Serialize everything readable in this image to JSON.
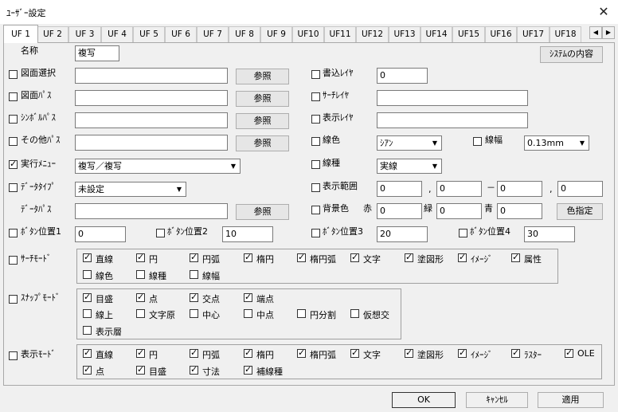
{
  "window": {
    "title": "ﾕｰｻﾞｰ設定",
    "close": "✕"
  },
  "tabs": [
    "UF 1",
    "UF 2",
    "UF 3",
    "UF 4",
    "UF 5",
    "UF 6",
    "UF 7",
    "UF 8",
    "UF 9",
    "UF10",
    "UF11",
    "UF12",
    "UF13",
    "UF14",
    "UF15",
    "UF16",
    "UF17",
    "UF18"
  ],
  "tab_scroll": {
    "left": "◀",
    "right": "▶"
  },
  "name": {
    "label": "名称",
    "value": "複写"
  },
  "system_button": "ｼｽﾃﾑの内容",
  "left_rows": [
    {
      "label": "図面選択",
      "checked": false,
      "value": "",
      "button": "参照"
    },
    {
      "label": "図面ﾊﾟｽ",
      "checked": false,
      "value": "",
      "button": "参照"
    },
    {
      "label": "ｼﾝﾎﾞﾙﾊﾟｽ",
      "checked": false,
      "value": "",
      "button": "参照"
    },
    {
      "label": "その他ﾊﾟｽ",
      "checked": false,
      "value": "",
      "button": "参照"
    }
  ],
  "exec_menu": {
    "label": "実行ﾒﾆｭｰ",
    "checked": true,
    "value": "複写／複写"
  },
  "data_type": {
    "label": "ﾃﾞｰﾀﾀｲﾌﾟ",
    "checked": false,
    "value": "未設定"
  },
  "data_path": {
    "label": "ﾃﾞｰﾀﾊﾟｽ",
    "value": "",
    "button": "参照"
  },
  "right_rows": {
    "write_layer": {
      "label": "書込ﾚｲﾔ",
      "value": "0"
    },
    "search_layer": {
      "label": "ｻｰﾁﾚｲﾔ",
      "value": ""
    },
    "display_layer": {
      "label": "表示ﾚｲﾔ",
      "value": ""
    },
    "line_color": {
      "label": "線色",
      "value": "ｼｱﾝ"
    },
    "line_width": {
      "label": "線幅",
      "value": "0.13mm"
    },
    "line_type": {
      "label": "線種",
      "value": "実線"
    },
    "display_range": {
      "label": "表示範囲",
      "v1": "0",
      "v2": "0",
      "v3": "0",
      "v4": "0",
      "sep1": ",",
      "sep2": "－",
      "sep3": ","
    },
    "background": {
      "label": "背景色",
      "red_label": "赤",
      "red": "0",
      "green_label": "緑",
      "green": "0",
      "blue_label": "青",
      "blue": "0",
      "button": "色指定"
    }
  },
  "button_positions": [
    {
      "label": "ﾎﾞﾀﾝ位置1",
      "value": "0"
    },
    {
      "label": "ﾎﾞﾀﾝ位置2",
      "value": "10"
    },
    {
      "label": "ﾎﾞﾀﾝ位置3",
      "value": "20"
    },
    {
      "label": "ﾎﾞﾀﾝ位置4",
      "value": "30"
    }
  ],
  "search_mode": {
    "label": "ｻｰﾁﾓｰﾄﾞ",
    "options": [
      {
        "label": "直線",
        "checked": true
      },
      {
        "label": "円",
        "checked": true
      },
      {
        "label": "円弧",
        "checked": true
      },
      {
        "label": "楕円",
        "checked": true
      },
      {
        "label": "楕円弧",
        "checked": true
      },
      {
        "label": "文字",
        "checked": true
      },
      {
        "label": "塗図形",
        "checked": true
      },
      {
        "label": "ｲﾒｰｼﾞ",
        "checked": true
      },
      {
        "label": "属性",
        "checked": true
      },
      {
        "label": "線色",
        "checked": false
      },
      {
        "label": "線種",
        "checked": false
      },
      {
        "label": "線幅",
        "checked": false
      }
    ]
  },
  "snap_mode": {
    "label": "ｽﾅｯﾌﾟﾓｰﾄﾞ",
    "options": [
      {
        "label": "目盛",
        "checked": true
      },
      {
        "label": "点",
        "checked": true
      },
      {
        "label": "交点",
        "checked": true
      },
      {
        "label": "端点",
        "checked": true
      },
      {
        "label": "線上",
        "checked": false
      },
      {
        "label": "文字原",
        "checked": false
      },
      {
        "label": "中心",
        "checked": false
      },
      {
        "label": "中点",
        "checked": false
      },
      {
        "label": "円分割",
        "checked": false
      },
      {
        "label": "仮想交",
        "checked": false
      },
      {
        "label": "表示層",
        "checked": false
      }
    ]
  },
  "display_mode": {
    "label": "表示ﾓｰﾄﾞ",
    "options": [
      {
        "label": "直線",
        "checked": true
      },
      {
        "label": "円",
        "checked": true
      },
      {
        "label": "円弧",
        "checked": true
      },
      {
        "label": "楕円",
        "checked": true
      },
      {
        "label": "楕円弧",
        "checked": true
      },
      {
        "label": "文字",
        "checked": true
      },
      {
        "label": "塗図形",
        "checked": true
      },
      {
        "label": "ｲﾒｰｼﾞ",
        "checked": true
      },
      {
        "label": "ﾗｽﾀｰ",
        "checked": true
      },
      {
        "label": "OLE",
        "checked": true
      },
      {
        "label": "点",
        "checked": true
      },
      {
        "label": "目盛",
        "checked": true
      },
      {
        "label": "寸法",
        "checked": true
      },
      {
        "label": "補線種",
        "checked": true
      }
    ]
  },
  "footer": {
    "ok": "OK",
    "cancel": "ｷｬﾝｾﾙ",
    "apply": "適用"
  }
}
